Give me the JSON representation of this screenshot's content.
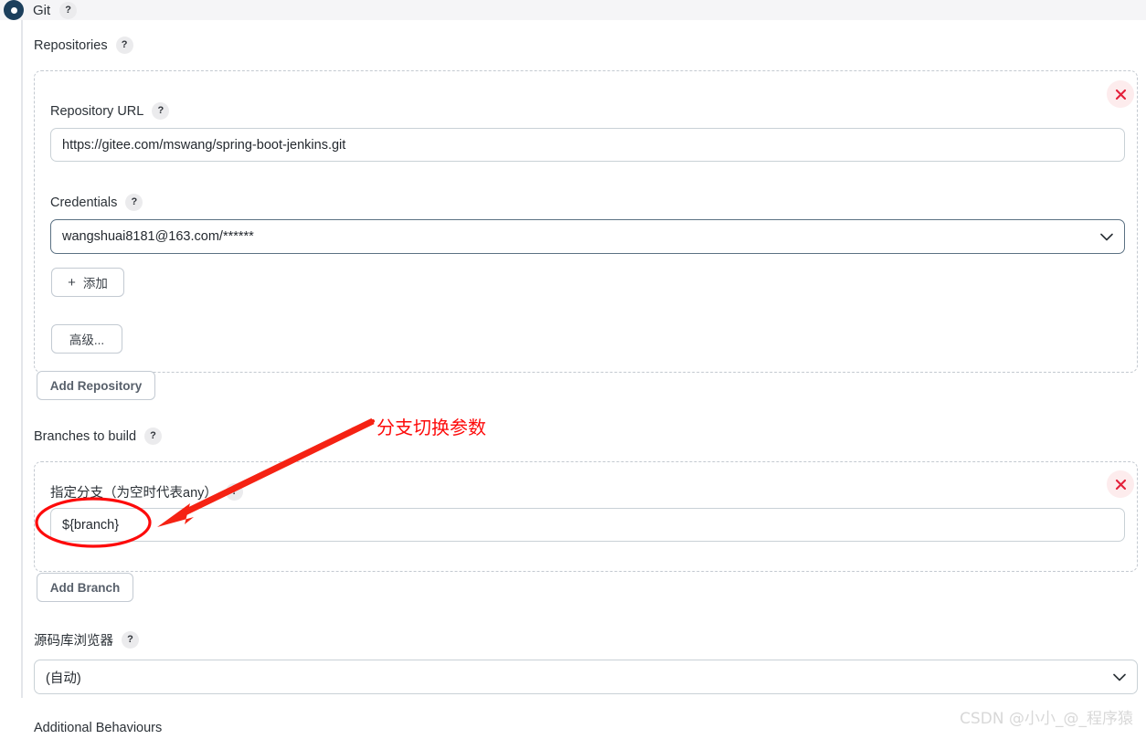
{
  "scm": {
    "selected_label": "Git",
    "help": "?"
  },
  "sections": {
    "repositories_label": "Repositories",
    "branches_label": "Branches to build",
    "repo_browser_label": "源码库浏览器",
    "additional_behaviours_label": "Additional Behaviours"
  },
  "repository": {
    "url_label": "Repository URL",
    "url_value": "https://gitee.com/mswang/spring-boot-jenkins.git",
    "credentials_label": "Credentials",
    "credentials_value": "wangshuai8181@163.com/******",
    "add_credentials_label": "添加",
    "add_credentials_plus": "+",
    "advanced_label": "高级...",
    "add_repository_label": "Add Repository",
    "delete_icon": "close-icon"
  },
  "branch": {
    "specifier_label": "指定分支（为空时代表any）",
    "specifier_value": "${branch}",
    "add_branch_label": "Add Branch",
    "delete_icon": "close-icon"
  },
  "repo_browser": {
    "selected_value": "(自动)",
    "chevron_icon": "chevron-down-icon"
  },
  "annotation": {
    "text": "分支切换参数",
    "color": "#fd0b0b"
  },
  "watermark": {
    "text": "CSDN @小小_@_程序猿"
  },
  "colors": {
    "radio_fill": "#1c3f5c",
    "delete_red": "#e4203a",
    "delete_bg": "#fdeced",
    "dashed_border": "#c3c9d0",
    "annotation_red": "#fd0b0b"
  }
}
